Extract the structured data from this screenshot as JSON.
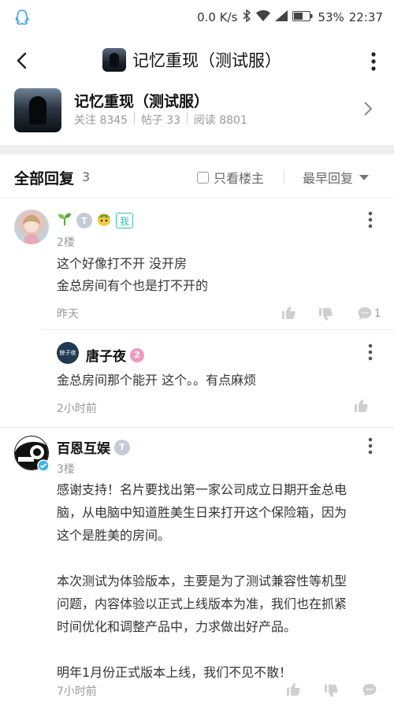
{
  "status": {
    "speed": "0.0 K/s",
    "battery": "53%",
    "time": "22:37"
  },
  "nav": {
    "title": "记忆重现（测试服）"
  },
  "forum": {
    "name": "记忆重现（测试服）",
    "follow": "关注 8345",
    "posts": "帖子 33",
    "reads": "阅读 8801"
  },
  "replies": {
    "label": "全部回复",
    "count": "3",
    "only_host": "只看楼主",
    "sort": "最早回复"
  },
  "posts": [
    {
      "floor": "2楼",
      "badges": {
        "t": "T",
        "me": "我"
      },
      "content_lines": [
        "这个好像打不开 没开房",
        "金总房间有个也是打不开的"
      ],
      "time": "昨天",
      "comment_count": "1",
      "sub_reply": {
        "avatar_text": "鲸子夜",
        "username": "唐子夜",
        "level": "2",
        "content": "金总房间那个能开 这个。。有点麻烦",
        "time": "2小时前"
      }
    },
    {
      "floor": "3楼",
      "username": "百恩互娱",
      "badges": {
        "t": "T"
      },
      "content_lines": [
        "感谢支持！名片要找出第一家公司成立日期开金总电",
        "脑，从电脑中知道胜美生日来打开这个保险箱，因为",
        "这个是胜美的房间。",
        "",
        "本次测试为体验版本，主要是为了测试兼容性等机型",
        "问题，内容体验以正式上线版本为准，我们也在抓紧",
        "时间优化和调整产品中，力求做出好产品。",
        "",
        "明年1月份正式版本上线，我们不见不散！"
      ],
      "time": "7小时前"
    }
  ]
}
